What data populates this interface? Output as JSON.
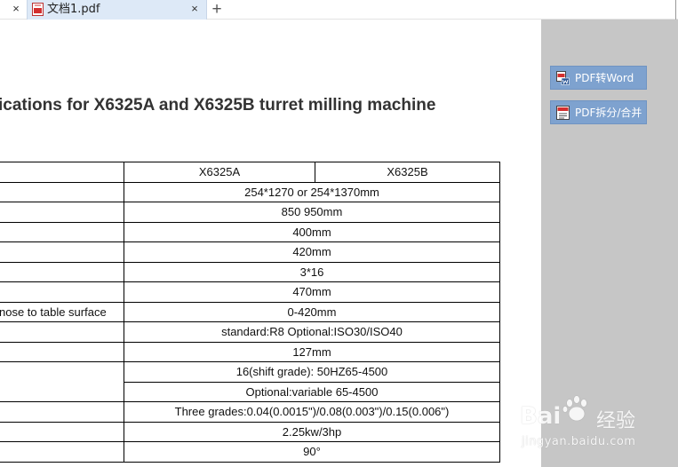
{
  "tabbar": {
    "active_tab_title": "文档1.pdf",
    "close_glyph": "×",
    "new_tab_glyph": "+"
  },
  "document": {
    "title": "ications for X6325A and X6325B turret milling machine",
    "table": {
      "header": {
        "label": "",
        "col_a": "X6325A",
        "col_b": "X6325B"
      },
      "rows": [
        {
          "label": "",
          "value": "254*1270 or 254*1370mm"
        },
        {
          "label": "",
          "value": "850 950mm"
        },
        {
          "label": "",
          "value": "400mm"
        },
        {
          "label": "",
          "value": "420mm"
        },
        {
          "label": "",
          "value": "3*16"
        },
        {
          "label": "",
          "value": "470mm"
        },
        {
          "label": "nose to table surface",
          "value": "0-420mm"
        },
        {
          "label": "",
          "value": "standard:R8 Optional:ISO30/ISO40"
        },
        {
          "label": "",
          "value": "127mm"
        },
        {
          "label": "",
          "value": "16(shift grade): 50HZ65-4500"
        },
        {
          "label": "",
          "value": "Optional:variable 65-4500"
        },
        {
          "label": "",
          "value": "Three grades:0.04(0.0015\")/0.08(0.003\")/0.15(0.006\")"
        },
        {
          "label": "",
          "value": "2.25kw/3hp"
        },
        {
          "label": "",
          "value": "90°"
        }
      ]
    }
  },
  "side_panel": {
    "pdf_to_word_label": "PDF转Word",
    "pdf_split_merge_label": "PDF拆分/合并",
    "accent_color": "#7ea2cf",
    "background_color": "#c6c6c6"
  },
  "watermark": {
    "logo": "Bai",
    "logo_suffix": "经验",
    "url": "jingyan.baidu.com"
  }
}
